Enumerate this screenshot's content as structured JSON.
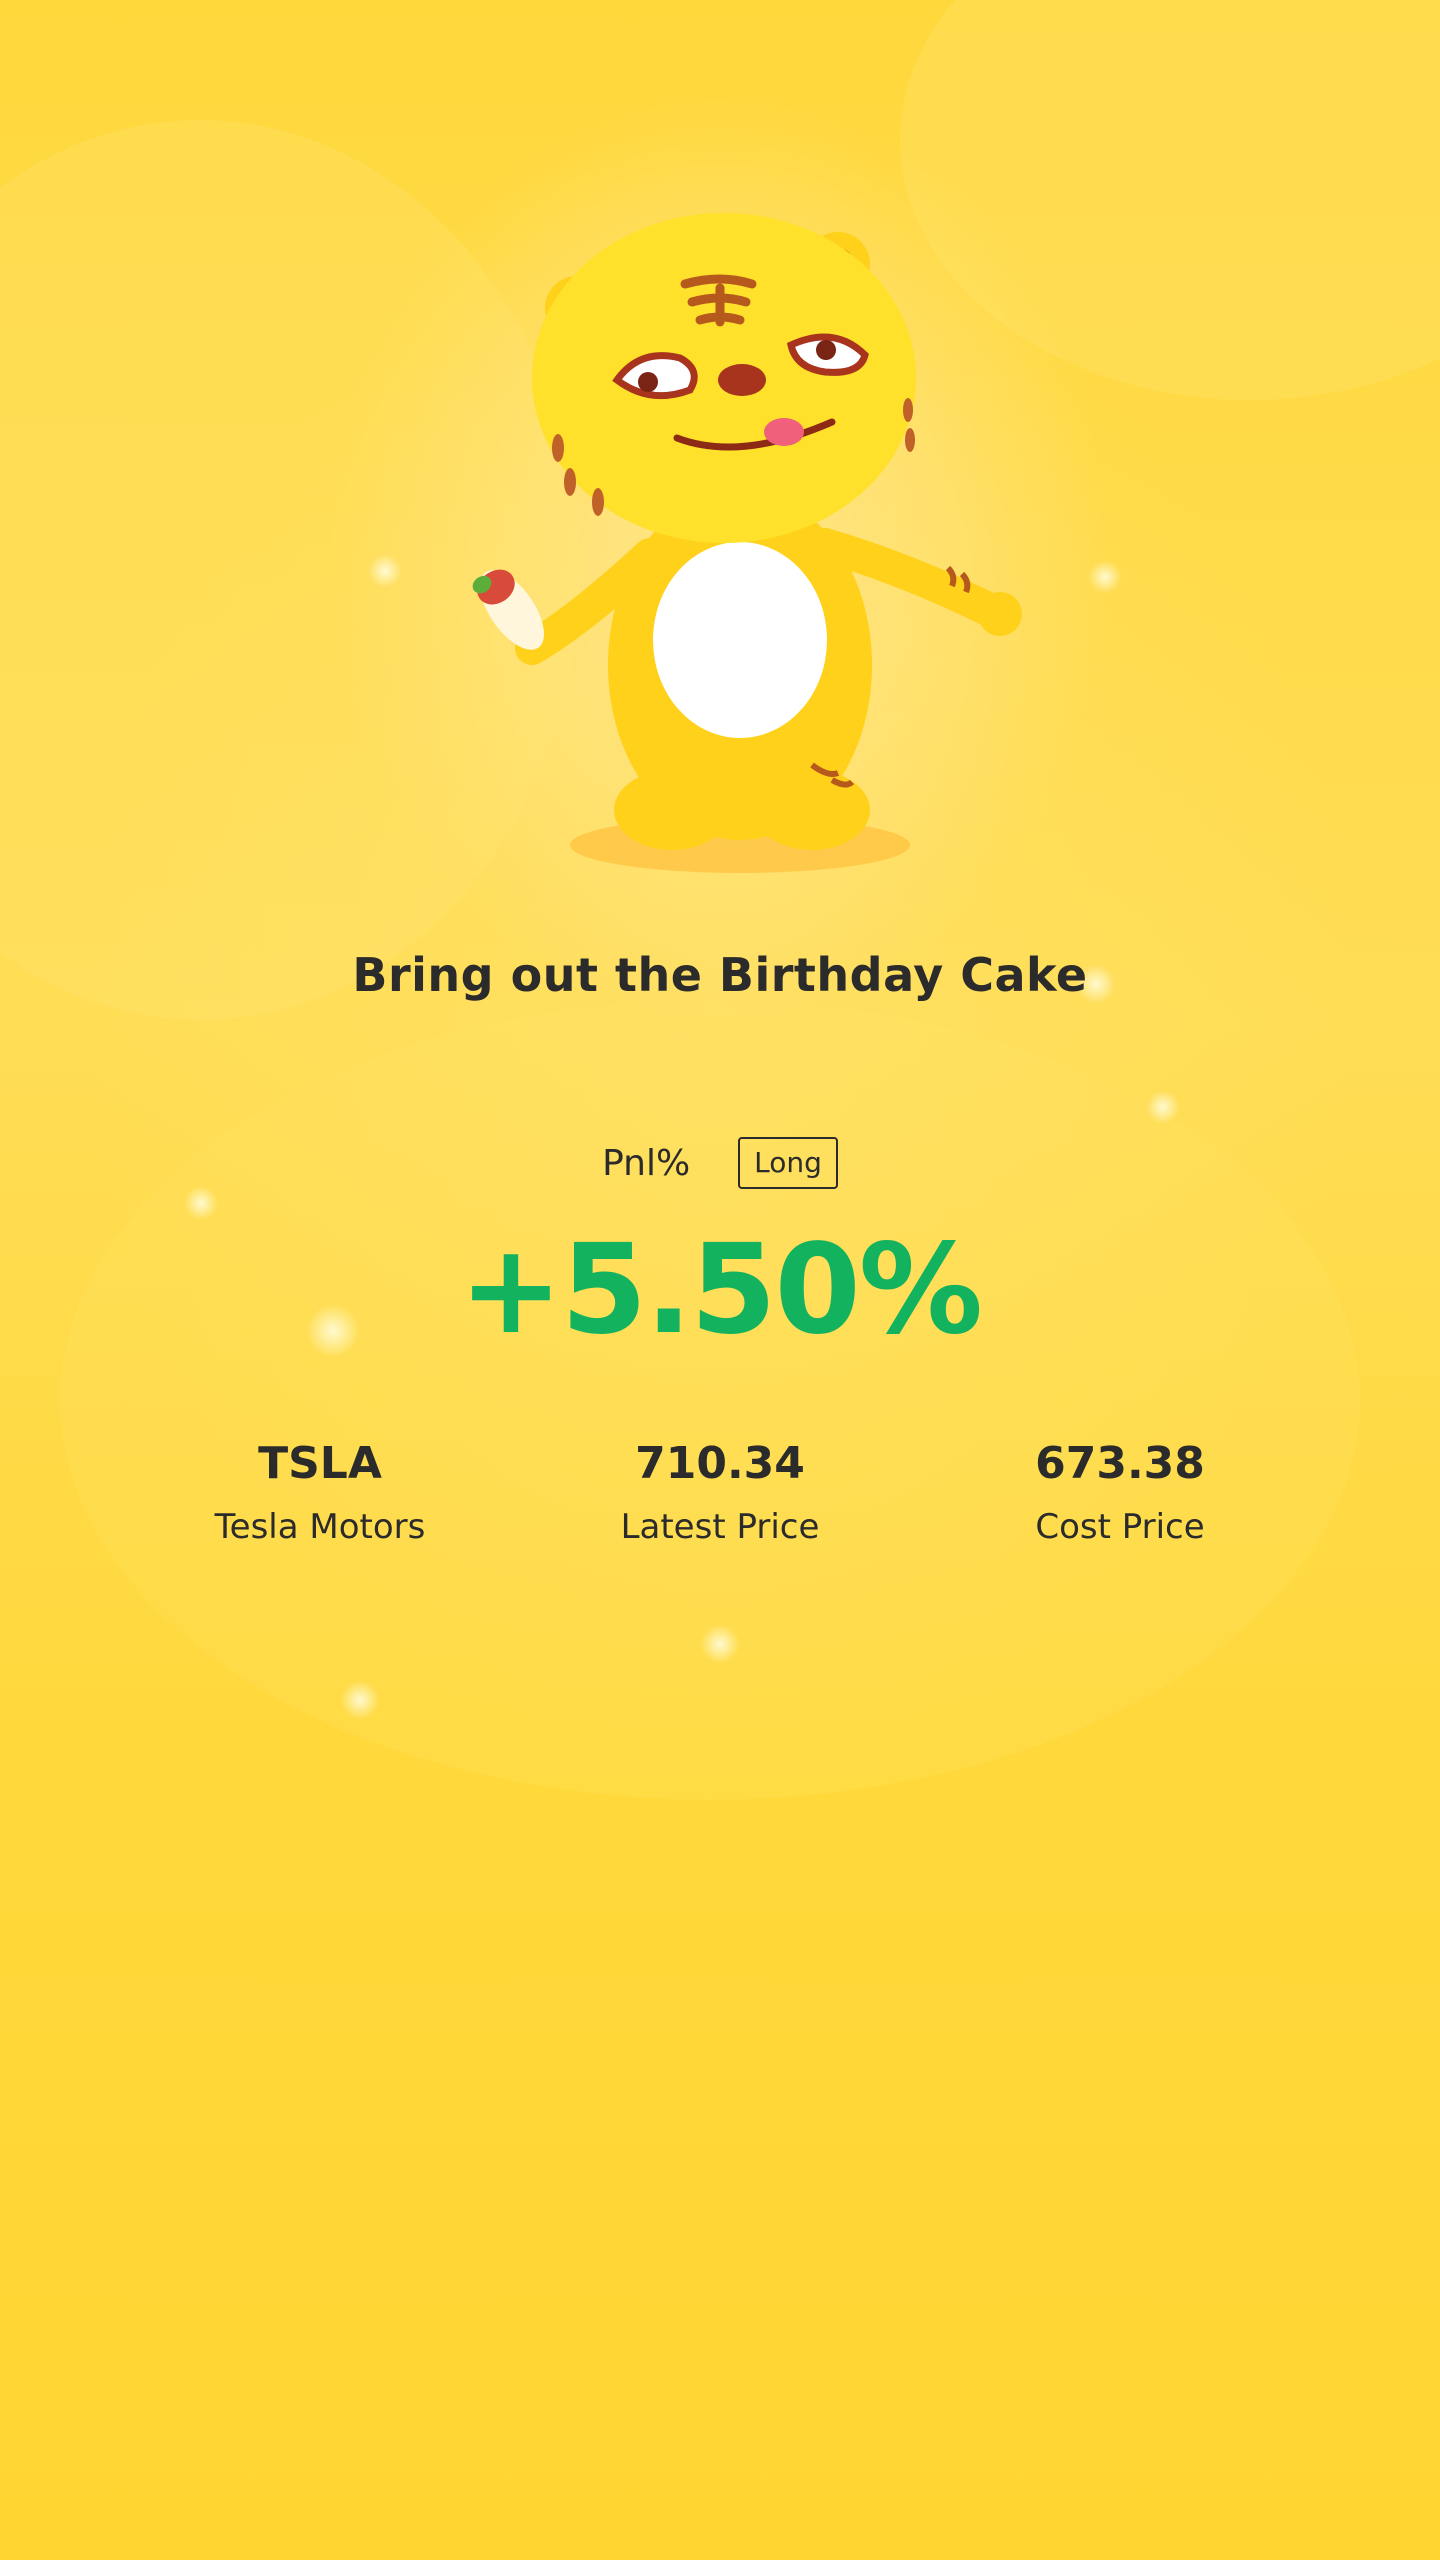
{
  "card": {
    "title": "Bring out the Birthday Cake",
    "pnl_label": "Pnl%",
    "direction": "Long",
    "pnl_value": "+5.50%",
    "pnl_color": "#12b25f",
    "background_color": "#ffd93a",
    "mascot": "tiger-mascot-illustration"
  },
  "stats": [
    {
      "value": "TSLA",
      "label": "Tesla Motors"
    },
    {
      "value": "710.34",
      "label": "Latest Price"
    },
    {
      "value": "673.38",
      "label": "Cost Price"
    }
  ]
}
